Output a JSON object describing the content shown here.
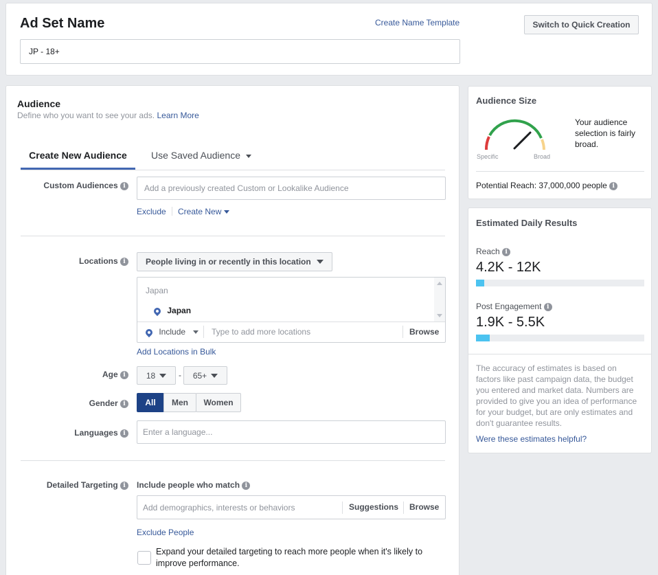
{
  "header": {
    "title": "Ad Set Name",
    "create_template": "Create Name Template",
    "switch_button": "Switch to Quick Creation",
    "name_value": "JP - 18+"
  },
  "audience": {
    "title": "Audience",
    "subtitle": "Define who you want to see your ads.",
    "learn_more": "Learn More",
    "tabs": {
      "create_new": "Create New Audience",
      "use_saved": "Use Saved Audience"
    },
    "custom_audiences": {
      "label": "Custom Audiences",
      "placeholder": "Add a previously created Custom or Lookalike Audience",
      "exclude": "Exclude",
      "create_new": "Create New"
    },
    "locations": {
      "label": "Locations",
      "dropdown": "People living in or recently in this location",
      "group_label": "Japan",
      "selected": "Japan",
      "include": "Include",
      "placeholder": "Type to add more locations",
      "browse": "Browse",
      "bulk": "Add Locations in Bulk"
    },
    "age": {
      "label": "Age",
      "min": "18",
      "sep": "-",
      "max": "65+"
    },
    "gender": {
      "label": "Gender",
      "all": "All",
      "men": "Men",
      "women": "Women"
    },
    "languages": {
      "label": "Languages",
      "placeholder": "Enter a language..."
    },
    "detailed": {
      "label": "Detailed Targeting",
      "include_label": "Include people who match",
      "placeholder": "Add demographics, interests or behaviors",
      "suggestions": "Suggestions",
      "browse": "Browse",
      "exclude": "Exclude People",
      "expand_text": "Expand your detailed targeting to reach more people when it's likely to improve performance."
    }
  },
  "audience_size": {
    "title": "Audience Size",
    "description": "Your audience selection is fairly broad.",
    "specific": "Specific",
    "broad": "Broad",
    "potential_reach": "Potential Reach: 37,000,000 people"
  },
  "estimated": {
    "title": "Estimated Daily Results",
    "reach_label": "Reach",
    "reach_value": "4.2K - 12K",
    "reach_fraction": 0.05,
    "engagement_label": "Post Engagement",
    "engagement_value": "1.9K - 5.5K",
    "engagement_fraction": 0.08,
    "disclaimer": "The accuracy of estimates is based on factors like past campaign data, the budget you entered and market data. Numbers are provided to give you an idea of performance for your budget, but are only estimates and don't guarantee results.",
    "helpful": "Were these estimates helpful?"
  },
  "colors": {
    "link": "#365899",
    "accent_blue": "#4267b2",
    "bar_fill": "#4cc3f0",
    "selected_gender": "#1d4286"
  }
}
